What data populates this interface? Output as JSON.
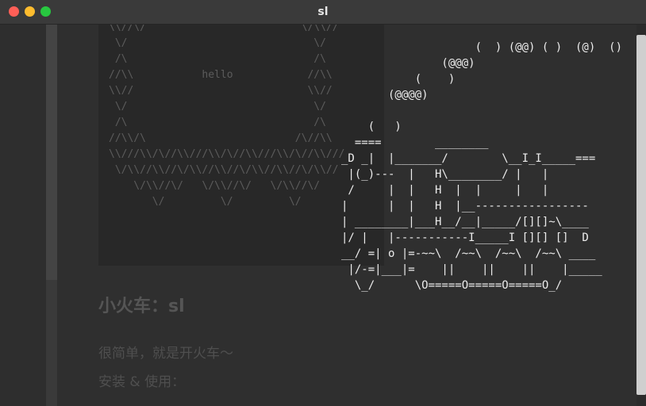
{
  "window": {
    "title": "sl"
  },
  "background_ascii": "\\\\//\\/                         \\/\\\\//\n \\/                              \\/\n /\\                              /\\\n//\\\\           hello            //\\\\\n\\\\//                            \\\\//\n \\/                              \\/\n /\\                              /\\\n//\\\\/\\                        /\\//\\\\\n\\\\///\\\\/\\//\\\\///\\\\/\\//\\\\///\\\\/\\//\\\\///\n \\/\\\\//\\\\//\\/\\\\//\\\\//\\/\\\\//\\\\//\\/\\\\//\n    \\/\\\\//\\/   \\/\\\\//\\/   \\/\\\\//\\/\n       \\/         \\/         \\/",
  "train_ascii": "                    (  ) (@@) ( )  (@)  ()\n               (@@@)\n           (    )\n       (@@@@)\n\n    (   )\n  ====        ________\n_D _|  |_______/        \\__I_I_____===\n |(_)---  |   H\\________/ |   |\n /     |  |   H  |  |     |   |\n|      |  |   H  |__-----------------\n| ________|___H__/__|_____/[][]~\\____\n|/ |   |-----------I_____I [][] []  D\n__/ =| o |=-~~\\  /~~\\  /~~\\  /~~\\ ____\n |/-=|___|=    ||    ||    ||    |_____\n  \\_/      \\O=====O=====O=====O_/",
  "doc": {
    "heading": "小火车：sl",
    "line1": "很简单，就是开火车～",
    "line2": "安装 & 使用："
  }
}
